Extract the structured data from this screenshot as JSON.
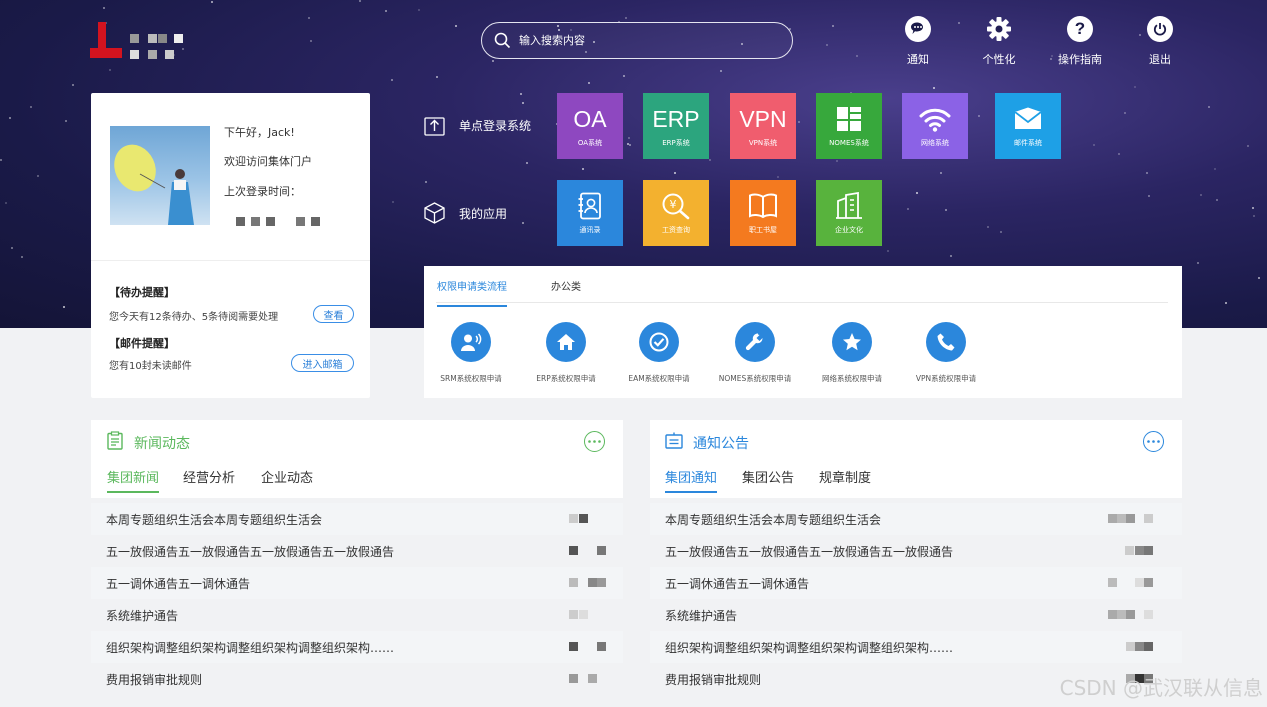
{
  "colors": {
    "accent": "#2b87dc",
    "news_green": "#5bb85d",
    "notice_blue": "#2b87dc"
  },
  "search": {
    "placeholder": "输入搜索内容"
  },
  "topnav": [
    {
      "label": "通知",
      "icon": "chat-bubble-icon"
    },
    {
      "label": "个性化",
      "icon": "gear-icon"
    },
    {
      "label": "操作指南",
      "icon": "question-icon"
    },
    {
      "label": "退出",
      "icon": "power-icon"
    }
  ],
  "user": {
    "greeting": "下午好，Jack!",
    "welcome": "欢迎访问集体门户",
    "last_login_label": "上次登录时间："
  },
  "reminders": {
    "todo_title": "【待办提醒】",
    "todo_text": "您今天有12条待办、5条待阅需要处理",
    "todo_button": "查看",
    "mail_title": "【邮件提醒】",
    "mail_text": "您有10封未读邮件",
    "mail_button": "进入邮箱"
  },
  "sso": {
    "label": "单点登录系统",
    "tiles": [
      {
        "big": "OA",
        "small": "OA系统",
        "color": "#8e48c0",
        "icon": ""
      },
      {
        "big": "ERP",
        "small": "ERP系统",
        "color": "#2ca57e",
        "icon": ""
      },
      {
        "big": "VPN",
        "small": "VPN系统",
        "color": "#f05d6e",
        "icon": ""
      },
      {
        "big": "",
        "small": "NOMES系统",
        "color": "#37a83c",
        "icon": "grid-layout-icon"
      },
      {
        "big": "",
        "small": "网络系统",
        "color": "#8b62e6",
        "icon": "wifi-icon"
      },
      {
        "big": "",
        "small": "邮件系统",
        "color": "#1ea0e6",
        "icon": "mail-icon"
      }
    ]
  },
  "apps": {
    "label": "我的应用",
    "tiles": [
      {
        "small": "通讯录",
        "color": "#2b87dc",
        "icon": "contacts-icon"
      },
      {
        "small": "工资查询",
        "color": "#f3b12f",
        "icon": "salary-search-icon"
      },
      {
        "small": "职工书屋",
        "color": "#f47a1f",
        "icon": "book-icon"
      },
      {
        "small": "企业文化",
        "color": "#58b33d",
        "icon": "building-icon"
      }
    ]
  },
  "apply": {
    "tabs": [
      "权限申请类流程",
      "办公类"
    ],
    "items": [
      {
        "label": "SRM系统权限申请",
        "icon": "user-voice-icon"
      },
      {
        "label": "ERP系统权限申请",
        "icon": "home-icon"
      },
      {
        "label": "EAM系统权限申请",
        "icon": "check-circle-icon"
      },
      {
        "label": "NOMES系统权限申请",
        "icon": "wrench-icon"
      },
      {
        "label": "网络系统权限申请",
        "icon": "star-icon"
      },
      {
        "label": "VPN系统权限申请",
        "icon": "phone-icon"
      }
    ]
  },
  "news": {
    "title": "新闻动态",
    "tabs": [
      "集团新闻",
      "经营分析",
      "企业动态"
    ],
    "items": [
      "本周专题组织生活会本周专题组织生活会",
      "五一放假通告五一放假通告五一放假通告五一放假通告",
      "五一调休通告五一调休通告",
      "系统维护通告",
      "组织架构调整组织架构调整组织架构调整组织架构……",
      "费用报销审批规则"
    ]
  },
  "notice": {
    "title": "通知公告",
    "tabs": [
      "集团通知",
      "集团公告",
      "规章制度"
    ],
    "items": [
      "本周专题组织生活会本周专题组织生活会",
      "五一放假通告五一放假通告五一放假通告五一放假通告",
      "五一调休通告五一调休通告",
      "系统维护通告",
      "组织架构调整组织架构调整组织架构调整组织架构……",
      "费用报销审批规则"
    ]
  },
  "watermark": "CSDN @武汉联从信息"
}
